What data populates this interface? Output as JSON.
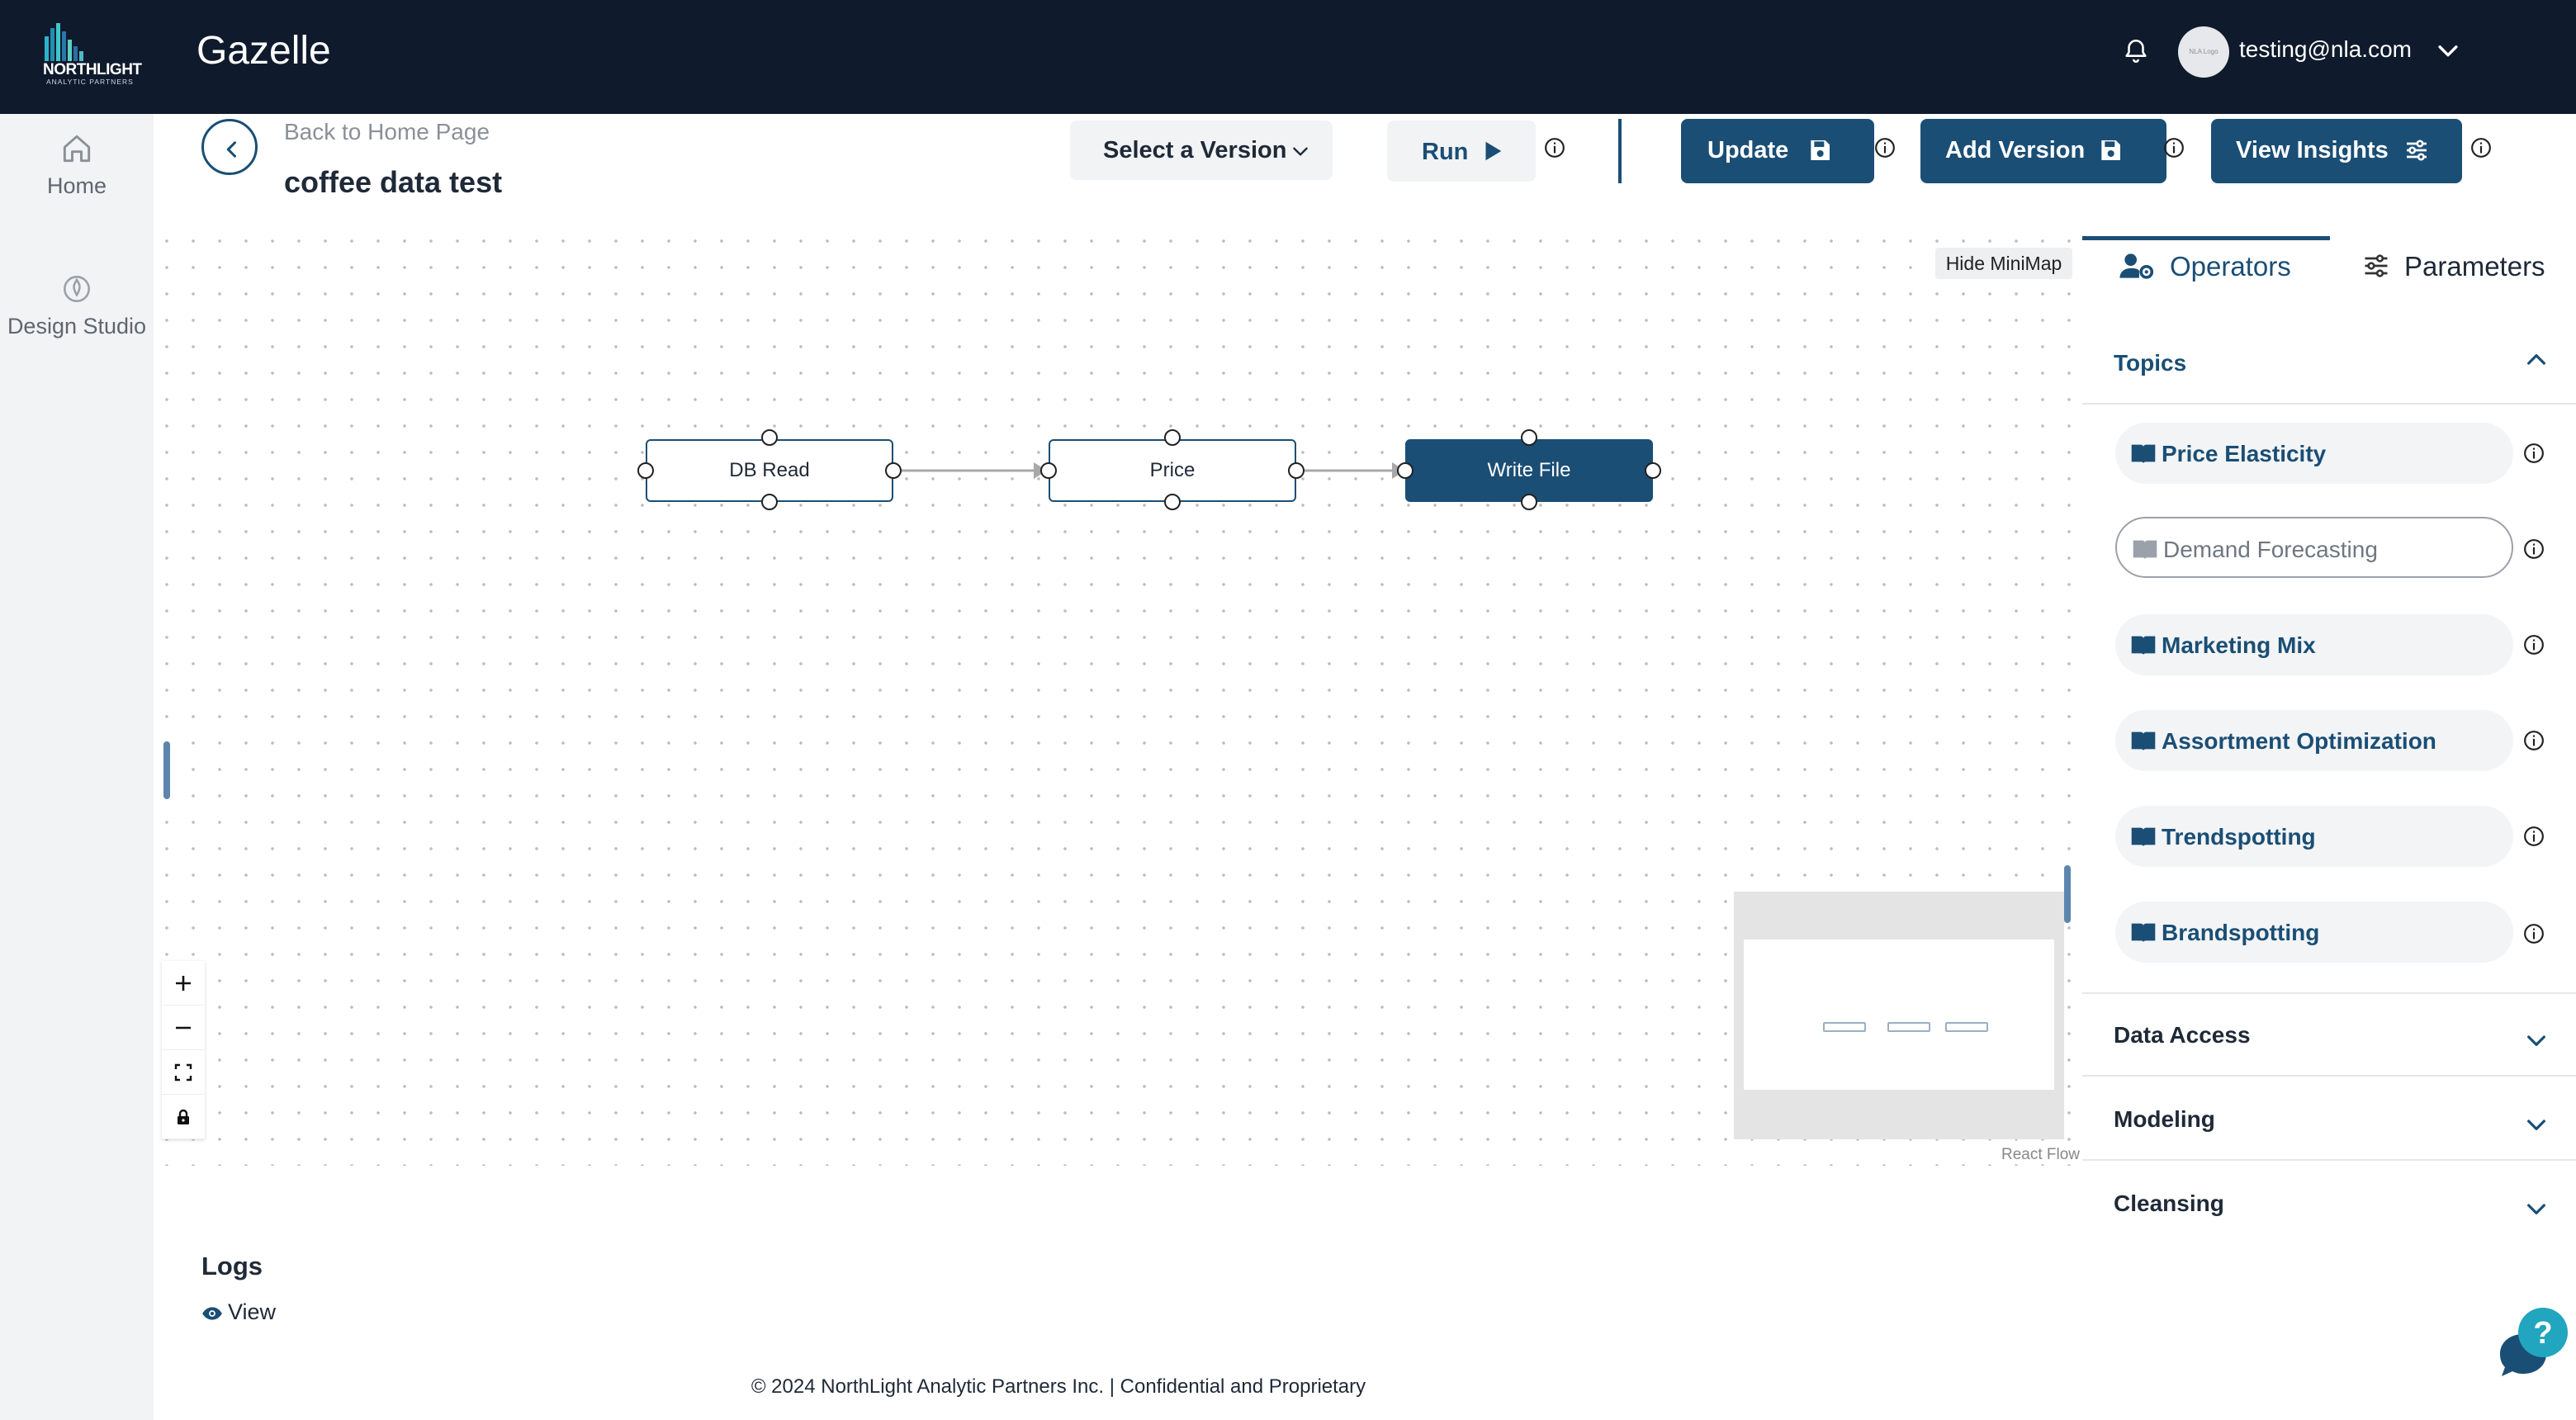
{
  "brand": {
    "logo_word": "NORTHLIGHT",
    "logo_sub": "ANALYTIC PARTNERS"
  },
  "app": {
    "title": "Gazelle"
  },
  "user": {
    "email": "testing@nla.com",
    "avatar_text": "NLA Logo"
  },
  "nav": {
    "home_label": "Home",
    "design_studio_label": "Design Studio"
  },
  "header": {
    "back_label": "Back to Home Page",
    "project_title": "coffee data test",
    "version_select_label": "Select a Version",
    "run_label": "Run",
    "update_label": "Update",
    "add_version_label": "Add Version",
    "view_insights_label": "View Insights"
  },
  "canvas": {
    "minimap_toggle": "Hide MiniMap",
    "attribution": "React Flow",
    "nodes": [
      {
        "label": "DB Read"
      },
      {
        "label": "Price"
      },
      {
        "label": "Write File"
      }
    ]
  },
  "panel": {
    "tabs": [
      {
        "label": "Operators",
        "active": true
      },
      {
        "label": "Parameters",
        "active": false
      }
    ],
    "topics_header": "Topics",
    "topics": [
      {
        "label": "Price Elasticity"
      },
      {
        "label": "Demand Forecasting",
        "selected": true
      },
      {
        "label": "Marketing Mix"
      },
      {
        "label": "Assortment Optimization"
      },
      {
        "label": "Trendspotting"
      },
      {
        "label": "Brandspotting"
      }
    ],
    "sections": [
      {
        "label": "Data Access"
      },
      {
        "label": "Modeling"
      },
      {
        "label": "Cleansing"
      }
    ]
  },
  "logs": {
    "title": "Logs",
    "view_label": "View"
  },
  "footer": {
    "text": "© 2024 NorthLight Analytic Partners Inc. | Confidential and Proprietary"
  },
  "colors": {
    "topbar": "#0f1a2c",
    "primary": "#1a4e75",
    "nav_bg": "#f2f3f5"
  }
}
